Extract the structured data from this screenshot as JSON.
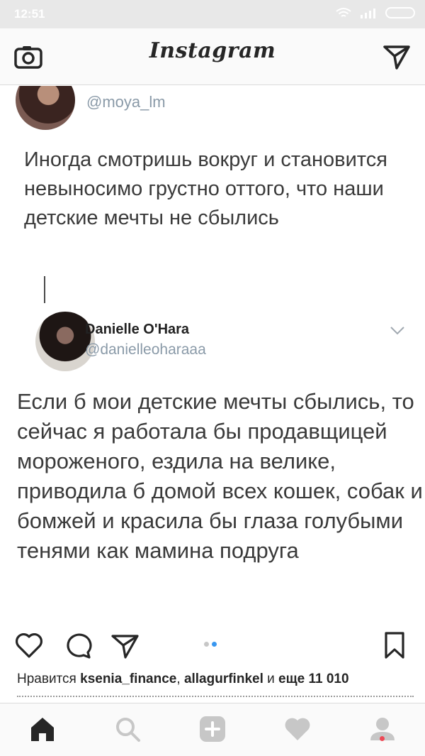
{
  "status_bar": {
    "time": "12:51"
  },
  "app_bar": {
    "logo": "Instagram",
    "left_icon": "camera-icon",
    "right_icon": "direct-message-icon"
  },
  "post": {
    "tweet_1": {
      "handle": "@moya_lm",
      "text": "Иногда смотришь вокруг и становится невыносимо грустно оттого, что наши детские мечты не сбылись"
    },
    "tweet_2": {
      "name": "Danielle O'Hara",
      "handle": "@danielleoharaaa",
      "text": "Если б мои детские мечты сбылись, то сейчас я работала бы продавщицей мороженого, ездила на велике, приводила б домой всех кошек, собак и бомжей и красила бы глаза голубыми тенями как мамина подруга"
    }
  },
  "actions": {
    "icons": [
      "heart-icon",
      "comment-icon",
      "share-icon",
      "bookmark-icon"
    ],
    "carousel_dots": 2,
    "active_dot": 2
  },
  "likes": {
    "prefix": "Нравится",
    "user1": "ksenia_finance",
    "sep": ",",
    "user2": "allagurfinkel",
    "and": "и",
    "more": "еще 11 010"
  },
  "bottom_nav": {
    "items": [
      "home-icon",
      "search-icon",
      "add-icon",
      "activity-icon",
      "profile-icon"
    ],
    "accent": "#ed4956"
  },
  "colors": {
    "link_blue": "#3897f0",
    "handle_gray": "#8a9aa8"
  }
}
